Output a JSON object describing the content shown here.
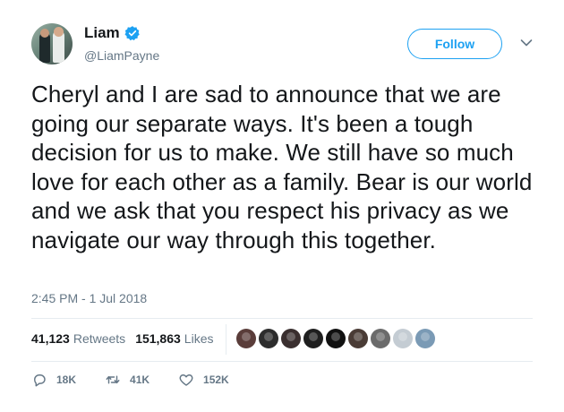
{
  "author": {
    "display_name": "Liam",
    "handle": "@LiamPayne",
    "verified": true,
    "avatar_icon": "profile-photo"
  },
  "follow_button": {
    "label": "Follow"
  },
  "tweet": {
    "text": "Cheryl and I are sad to announce that we are going our separate ways. It's been a tough decision for us to make. We still have so much love for each other as a family. Bear is our world and we ask that you respect his privacy as we navigate our way through this together.",
    "timestamp": "2:45 PM - 1 Jul 2018"
  },
  "stats": {
    "retweets_count": "41,123",
    "retweets_label": "Retweets",
    "likes_count": "151,863",
    "likes_label": "Likes"
  },
  "liker_avatars": [
    {
      "color": "#5a3d3a"
    },
    {
      "color": "#2d2d2d"
    },
    {
      "color": "#3a2f2f"
    },
    {
      "color": "#1f1f1f"
    },
    {
      "color": "#111111"
    },
    {
      "color": "#4a3c36"
    },
    {
      "color": "#6b6b6b"
    },
    {
      "color": "#c4ccd3"
    },
    {
      "color": "#7a9ab5"
    }
  ],
  "actions": {
    "replies_count": "18K",
    "retweets_count": "41K",
    "likes_count": "152K"
  },
  "colors": {
    "accent": "#1da1f2",
    "text": "#14171a",
    "muted": "#657786",
    "border": "#e6ecf0"
  }
}
